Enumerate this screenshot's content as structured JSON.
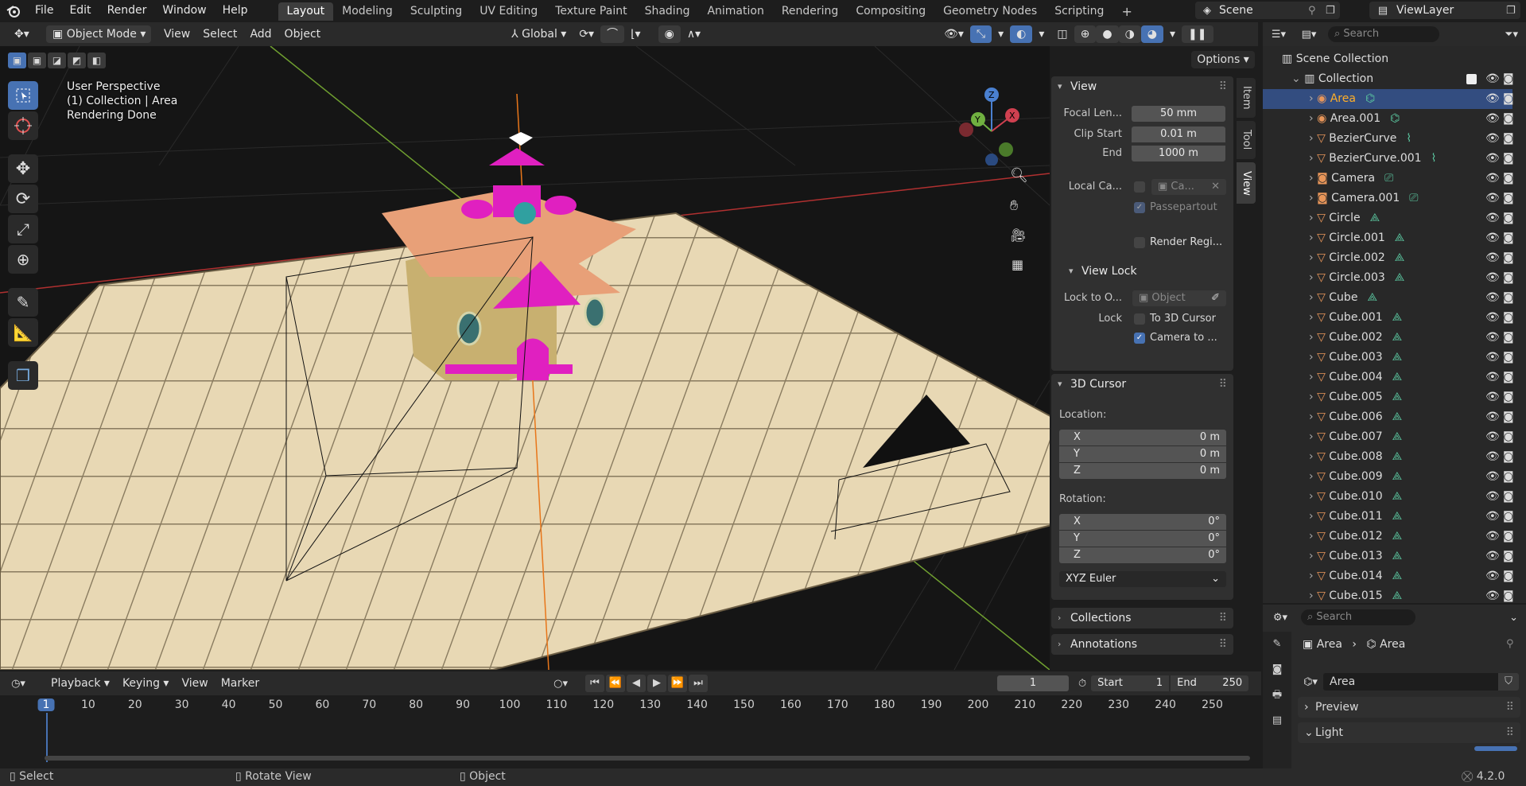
{
  "menubar": {
    "items": [
      "File",
      "Edit",
      "Render",
      "Window",
      "Help"
    ],
    "workspaces": [
      "Layout",
      "Modeling",
      "Sculpting",
      "UV Editing",
      "Texture Paint",
      "Shading",
      "Animation",
      "Rendering",
      "Compositing",
      "Geometry Nodes",
      "Scripting"
    ],
    "active_workspace": "Layout",
    "add_tab": "+",
    "scene_name": "Scene",
    "view_layer": "ViewLayer"
  },
  "viewport_header": {
    "mode": "Object Mode",
    "menus": [
      "View",
      "Select",
      "Add",
      "Object"
    ],
    "orientation": "Global",
    "options": "Options"
  },
  "viewport_overlay": {
    "line1": "User Perspective",
    "line2": "(1) Collection | Area",
    "line3": "Rendering Done"
  },
  "sidebar_tabs": [
    "Item",
    "Tool",
    "View"
  ],
  "view_panel": {
    "title": "View",
    "focal_label": "Focal Len...",
    "focal_value": "50 mm",
    "clip_start_label": "Clip Start",
    "clip_start_value": "0.01 m",
    "end_label": "End",
    "end_value": "1000 m",
    "local_camera_label": "Local Ca...",
    "local_camera_value": "Ca...",
    "passepartout": "Passepartout",
    "render_region": "Render Regi...",
    "view_lock_title": "View Lock",
    "lock_to_label": "Lock to O...",
    "lock_to_placeholder": "Object",
    "lock_label": "Lock",
    "to_3d_cursor": "To 3D Cursor",
    "camera_to": "Camera to ..."
  },
  "cursor_panel": {
    "title": "3D Cursor",
    "location_label": "Location:",
    "loc": [
      {
        "axis": "X",
        "value": "0 m"
      },
      {
        "axis": "Y",
        "value": "0 m"
      },
      {
        "axis": "Z",
        "value": "0 m"
      }
    ],
    "rotation_label": "Rotation:",
    "rot": [
      {
        "axis": "X",
        "value": "0°"
      },
      {
        "axis": "Y",
        "value": "0°"
      },
      {
        "axis": "Z",
        "value": "0°"
      }
    ],
    "rotation_mode": "XYZ Euler"
  },
  "collapsed_panels": [
    "Collections",
    "Annotations"
  ],
  "outliner": {
    "search_placeholder": "Search",
    "scene_collection": "Scene Collection",
    "collection": "Collection",
    "items": [
      {
        "name": "Area",
        "type": "light",
        "selected": true
      },
      {
        "name": "Area.001",
        "type": "light"
      },
      {
        "name": "BezierCurve",
        "type": "curve"
      },
      {
        "name": "BezierCurve.001",
        "type": "curve"
      },
      {
        "name": "Camera",
        "type": "camera"
      },
      {
        "name": "Camera.001",
        "type": "camera"
      },
      {
        "name": "Circle",
        "type": "mesh"
      },
      {
        "name": "Circle.001",
        "type": "mesh"
      },
      {
        "name": "Circle.002",
        "type": "mesh"
      },
      {
        "name": "Circle.003",
        "type": "mesh"
      },
      {
        "name": "Cube",
        "type": "mesh"
      },
      {
        "name": "Cube.001",
        "type": "mesh"
      },
      {
        "name": "Cube.002",
        "type": "mesh"
      },
      {
        "name": "Cube.003",
        "type": "mesh"
      },
      {
        "name": "Cube.004",
        "type": "mesh"
      },
      {
        "name": "Cube.005",
        "type": "mesh"
      },
      {
        "name": "Cube.006",
        "type": "mesh"
      },
      {
        "name": "Cube.007",
        "type": "mesh"
      },
      {
        "name": "Cube.008",
        "type": "mesh"
      },
      {
        "name": "Cube.009",
        "type": "mesh"
      },
      {
        "name": "Cube.010",
        "type": "mesh"
      },
      {
        "name": "Cube.011",
        "type": "mesh"
      },
      {
        "name": "Cube.012",
        "type": "mesh"
      },
      {
        "name": "Cube.013",
        "type": "mesh"
      },
      {
        "name": "Cube.014",
        "type": "mesh"
      },
      {
        "name": "Cube.015",
        "type": "mesh"
      }
    ]
  },
  "properties": {
    "search_placeholder": "Search",
    "breadcrumb_object": "Area",
    "breadcrumb_data": "Area",
    "data_name": "Area",
    "panels": [
      "Preview",
      "Light"
    ]
  },
  "timeline": {
    "menus": [
      "Playback",
      "Keying",
      "View",
      "Marker"
    ],
    "current_frame": "1",
    "start_label": "Start",
    "start": "1",
    "end_label": "End",
    "end": "250",
    "ticks": [
      "1",
      "10",
      "20",
      "30",
      "40",
      "50",
      "60",
      "70",
      "80",
      "90",
      "100",
      "110",
      "120",
      "130",
      "140",
      "150",
      "160",
      "170",
      "180",
      "190",
      "200",
      "210",
      "220",
      "230",
      "240",
      "250"
    ]
  },
  "statusbar": {
    "select": "Select",
    "rotate": "Rotate View",
    "object": "Object",
    "version": "4.2.0"
  },
  "colors": {
    "accent": "#4772b3",
    "selected_row": "#334d80",
    "active_name": "#ffaf29",
    "light_icon": "#e8965a",
    "data_icon": "#5bc7a0",
    "ground": "#e8d8b4",
    "house_pink": "#e020c0",
    "axis_red": "#b03030",
    "axis_green": "#70a030"
  }
}
